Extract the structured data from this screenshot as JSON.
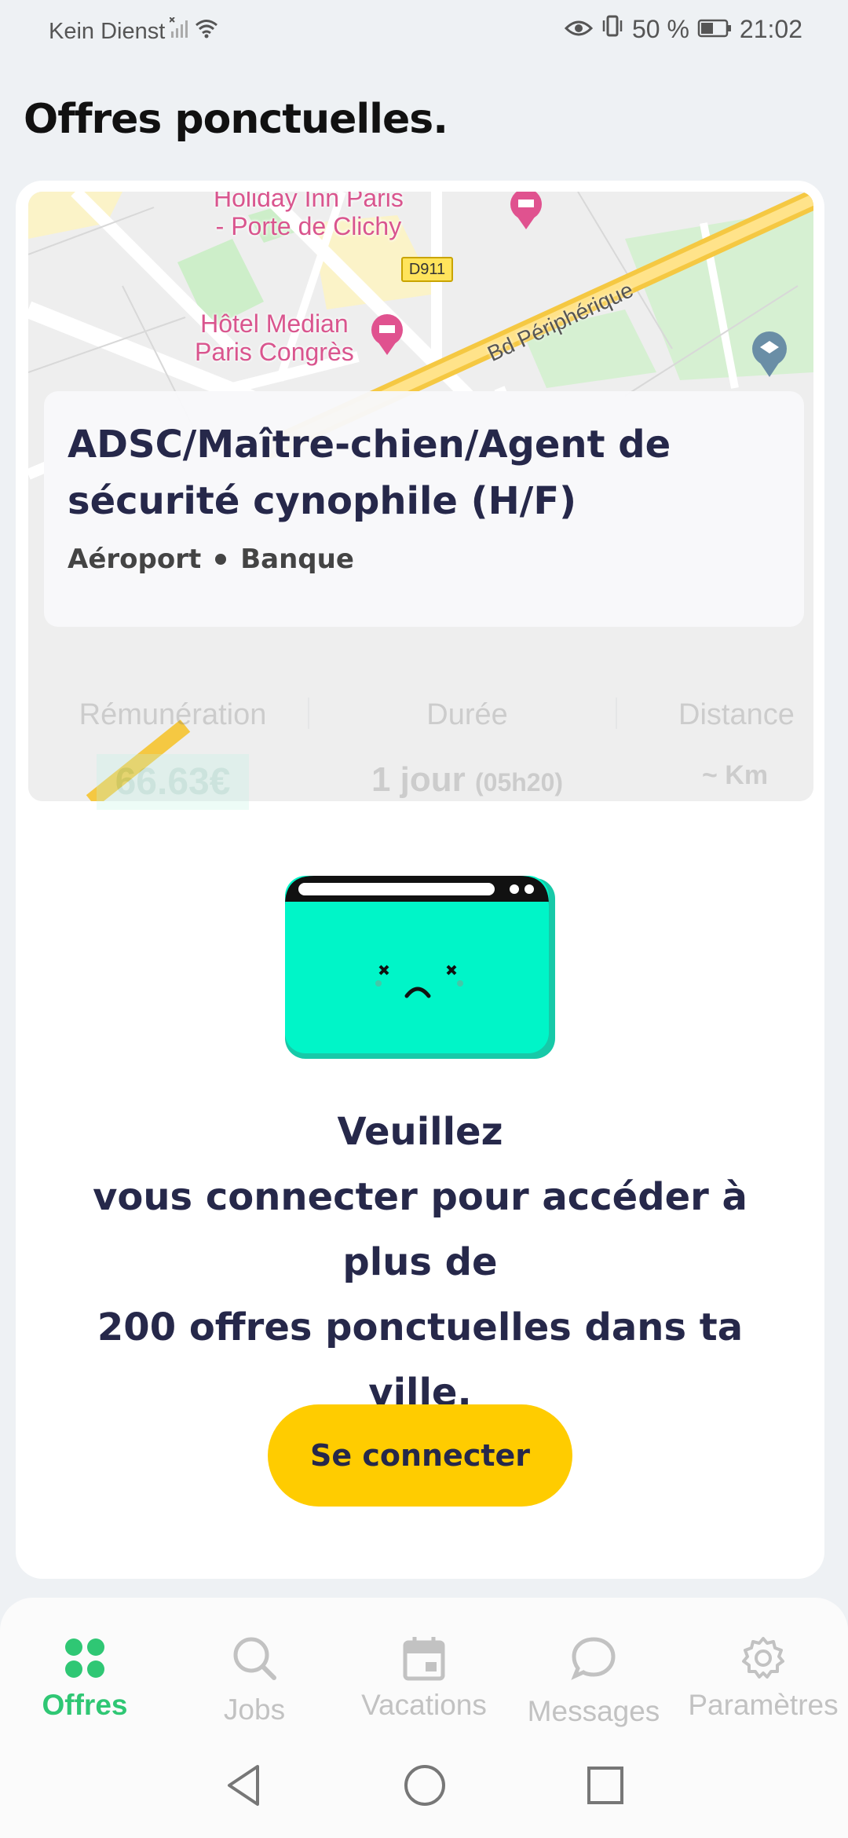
{
  "status_bar": {
    "carrier": "Kein Dienst",
    "battery": "50 %",
    "time": "21:02"
  },
  "page_title": "Offres ponctuelles.",
  "offer": {
    "map_labels": {
      "hotel1": "Holiday Inn Paris\n- Porte de Clichy",
      "hotel2": "Hôtel Median\nParis Congrès",
      "road": "Bd Périphérique",
      "route_shield": "D911",
      "station": "Porte de Clichy"
    },
    "title": "ADSC/Maître-chien/Agent de sécurité cynophile (H/F)",
    "tags": [
      "Aéroport",
      "Banque"
    ],
    "stats": {
      "pay_label": "Rémunération",
      "pay_value": "66.63€",
      "duration_label": "Durée",
      "duration_value": "1 jour",
      "duration_detail": "(05h20)",
      "distance_label": "Distance",
      "distance_value": "~ Km"
    }
  },
  "login_prompt": {
    "line1": "Veuillez",
    "line2": "vous connecter pour accéder à",
    "line3": "plus de",
    "line4": "200 offres ponctuelles dans ta ville.",
    "button": "Se connecter"
  },
  "bottom_nav": {
    "items": [
      {
        "label": "Offres",
        "icon": "grid-dots-icon",
        "active": true
      },
      {
        "label": "Jobs",
        "icon": "search-icon",
        "active": false
      },
      {
        "label": "Vacations",
        "icon": "calendar-icon",
        "active": false
      },
      {
        "label": "Messages",
        "icon": "chat-bubble-icon",
        "active": false
      },
      {
        "label": "Paramètres",
        "icon": "gear-icon",
        "active": false
      }
    ]
  },
  "colors": {
    "accent_green": "#2fc774",
    "button_yellow": "#ffcc00",
    "text_navy": "#26284a",
    "illustration_teal": "#00f5c8"
  }
}
